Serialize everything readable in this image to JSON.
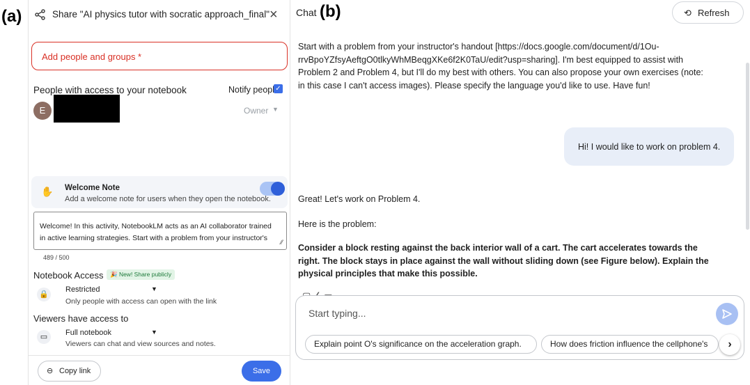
{
  "labels": {
    "a": "(a)",
    "b": "(b)"
  },
  "share_dialog": {
    "title": "Share \"AI physics tutor with socratic approach_final\"",
    "close_icon": "×",
    "people_placeholder": "Add people and groups *",
    "access_heading": "People with access to your notebook",
    "notify_label": "Notify people",
    "notify_checked": true,
    "member": {
      "avatar_letter": "E",
      "role": "Owner"
    },
    "welcome": {
      "title": "Welcome Note",
      "description": "Add a welcome note for users when they open the notebook.",
      "enabled": true,
      "note_text": "Welcome! In this activity, NotebookLM acts as an AI collaborator trained in active learning strategies. Start with a problem from your instructor's",
      "char_count": "489 / 500"
    },
    "notebook_access": {
      "heading": "Notebook Access",
      "badge": "🎉 New! Share publicly",
      "value": "Restricted",
      "description": "Only people with access can open with the link"
    },
    "viewers": {
      "heading": "Viewers have access to",
      "value": "Full notebook",
      "description": "Viewers can chat and view sources and notes."
    },
    "copy_link_label": "Copy link",
    "save_label": "Save"
  },
  "chat": {
    "title": "Chat",
    "refresh_label": "Refresh",
    "intro_message": "Start with a problem from your instructor's handout [https://docs.google.com/document/d/1Ou-rrvBpoYZfsyAeftgO0tlkyWhMBeqgXKe6f2K0TaU/edit?usp=sharing]. I'm best equipped to assist with Problem 2 and Problem 4, but I'll do my best with others. You can also propose your own exercises (note: in this case I can't access images). Please specify the language you'd like to use. Have fun!",
    "user_message": "Hi! I would like to work on problem 4.",
    "reply_1": "Great! Let's work on Problem 4.",
    "reply_2": "Here is the problem:",
    "reply_problem": "Consider a block resting against the back interior wall of a cart. The cart accelerates towards the right. The block stays in place against the wall without sliding down (see Figure below). Explain the physical principles that make this possible.",
    "input_placeholder": "Start typing...",
    "suggestions": [
      "Explain point O's significance on the acceleration graph.",
      "How does friction influence the cellphone's"
    ]
  },
  "colors": {
    "accent": "#3b6ee8",
    "error": "#d93025",
    "user_bubble": "#e8eef8",
    "send_button": "#a8c0f3"
  }
}
